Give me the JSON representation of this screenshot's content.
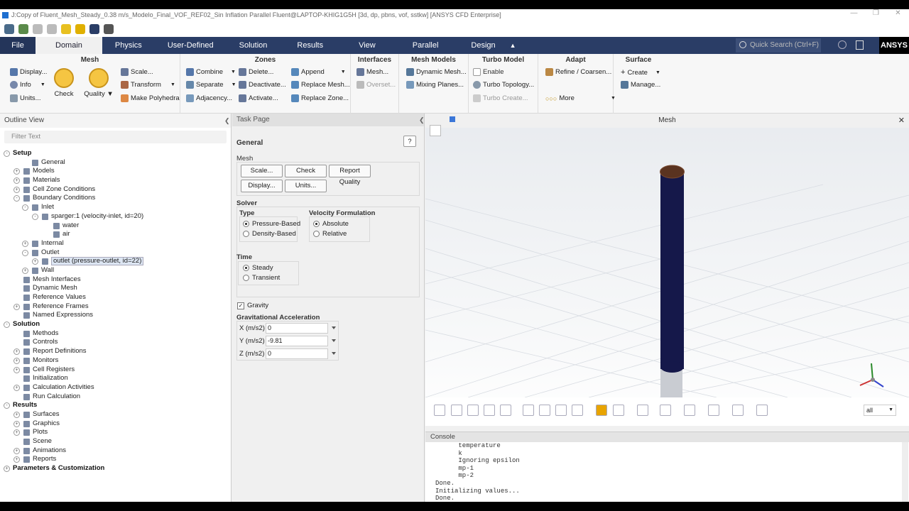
{
  "window": {
    "title": "J:Copy of Fluent_Mesh_Steady_0.38 m/s_Modelo_Final_VOF_REF02_Sin Inflation Parallel Fluent@LAPTOP-KHIG1G5H  [3d, dp, pbns, vof, sstkw] [ANSYS CFD Enterprise]"
  },
  "tabs": [
    "File",
    "Domain",
    "Physics",
    "User-Defined",
    "Solution",
    "Results",
    "View",
    "Parallel",
    "Design"
  ],
  "search": {
    "placeholder": "Quick Search (Ctrl+F)"
  },
  "brand": "ANSYS",
  "ribbon": {
    "mesh": {
      "title": "Mesh",
      "display": "Display...",
      "info": "Info",
      "units": "Units...",
      "check": "Check",
      "quality": "Quality",
      "scale": "Scale...",
      "transform": "Transform",
      "make_polyhedra": "Make Polyhedra"
    },
    "zones": {
      "title": "Zones",
      "combine": "Combine",
      "separate": "Separate",
      "adjacency": "Adjacency...",
      "delete": "Delete...",
      "deactivate": "Deactivate...",
      "activate": "Activate...",
      "append": "Append",
      "replace_mesh": "Replace Mesh...",
      "replace_zone": "Replace Zone..."
    },
    "interfaces": {
      "title": "Interfaces",
      "mesh": "Mesh...",
      "overset": "Overset..."
    },
    "mesh_models": {
      "title": "Mesh Models",
      "dynamic_mesh": "Dynamic Mesh...",
      "mixing_planes": "Mixing Planes..."
    },
    "turbo": {
      "title": "Turbo Model",
      "enable": "Enable",
      "topology": "Turbo Topology...",
      "create": "Turbo Create..."
    },
    "adapt": {
      "title": "Adapt",
      "refine": "Refine / Coarsen...",
      "more": "More"
    },
    "surface": {
      "title": "Surface",
      "create": "Create",
      "manage": "Manage..."
    }
  },
  "outline": {
    "title": "Outline View",
    "filter_placeholder": "Filter Text",
    "nodes": [
      {
        "label": "Setup",
        "level": 0,
        "head": true,
        "exp": "-"
      },
      {
        "label": "General",
        "level": 2
      },
      {
        "label": "Models",
        "level": 1,
        "exp": "+"
      },
      {
        "label": "Materials",
        "level": 1,
        "exp": "+"
      },
      {
        "label": "Cell Zone Conditions",
        "level": 1,
        "exp": "+"
      },
      {
        "label": "Boundary Conditions",
        "level": 1,
        "exp": "-"
      },
      {
        "label": "Inlet",
        "level": 2,
        "exp": "-"
      },
      {
        "label": "sparger:1 (velocity-inlet, id=20)",
        "level": 3,
        "exp": "-"
      },
      {
        "label": "water",
        "level": 4
      },
      {
        "label": "air",
        "level": 4
      },
      {
        "label": "Internal",
        "level": 2,
        "exp": "+"
      },
      {
        "label": "Outlet",
        "level": 2,
        "exp": "-"
      },
      {
        "label": "outlet (pressure-outlet, id=22)",
        "level": 3,
        "exp": "+",
        "sel": true
      },
      {
        "label": "Wall",
        "level": 2,
        "exp": "+"
      },
      {
        "label": "Mesh Interfaces",
        "level": 1
      },
      {
        "label": "Dynamic Mesh",
        "level": 1
      },
      {
        "label": "Reference Values",
        "level": 1
      },
      {
        "label": "Reference Frames",
        "level": 1,
        "exp": "+"
      },
      {
        "label": "Named Expressions",
        "level": 1
      },
      {
        "label": "Solution",
        "level": 0,
        "head": true,
        "exp": "-"
      },
      {
        "label": "Methods",
        "level": 1
      },
      {
        "label": "Controls",
        "level": 1
      },
      {
        "label": "Report Definitions",
        "level": 1,
        "exp": "+"
      },
      {
        "label": "Monitors",
        "level": 1,
        "exp": "+"
      },
      {
        "label": "Cell Registers",
        "level": 1,
        "exp": "+"
      },
      {
        "label": "Initialization",
        "level": 1
      },
      {
        "label": "Calculation Activities",
        "level": 1,
        "exp": "+"
      },
      {
        "label": "Run Calculation",
        "level": 1
      },
      {
        "label": "Results",
        "level": 0,
        "head": true,
        "exp": "-"
      },
      {
        "label": "Surfaces",
        "level": 1,
        "exp": "+"
      },
      {
        "label": "Graphics",
        "level": 1,
        "exp": "+"
      },
      {
        "label": "Plots",
        "level": 1,
        "exp": "+"
      },
      {
        "label": "Scene",
        "level": 1
      },
      {
        "label": "Animations",
        "level": 1,
        "exp": "+"
      },
      {
        "label": "Reports",
        "level": 1,
        "exp": "+"
      },
      {
        "label": "Parameters & Customization",
        "level": 0,
        "head": true,
        "exp": "+"
      }
    ]
  },
  "task": {
    "header": "Task Page",
    "title": "General",
    "mesh_label": "Mesh",
    "scale": "Scale...",
    "check": "Check",
    "report_quality": "Report Quality",
    "display": "Display...",
    "units": "Units...",
    "solver_label": "Solver",
    "type_label": "Type",
    "pressure_based": "Pressure-Based",
    "density_based": "Density-Based",
    "vel_label": "Velocity Formulation",
    "absolute": "Absolute",
    "relative": "Relative",
    "time_label": "Time",
    "steady": "Steady",
    "transient": "Transient",
    "gravity": "Gravity",
    "grav_acc_label": "Gravitational Acceleration",
    "x_label": "X (m/s2)",
    "x_val": "0",
    "y_label": "Y (m/s2)",
    "y_val": "-9.81",
    "z_label": "Z (m/s2)",
    "z_val": "0"
  },
  "viewport": {
    "title": "Mesh",
    "view_select": "all"
  },
  "console": {
    "title": "Console",
    "lines": [
      "      temperature",
      "      k",
      "      Ignoring epsilon",
      "      mp-1",
      "      mp-2",
      "Done.",
      "Initializing values...",
      "Done."
    ]
  }
}
